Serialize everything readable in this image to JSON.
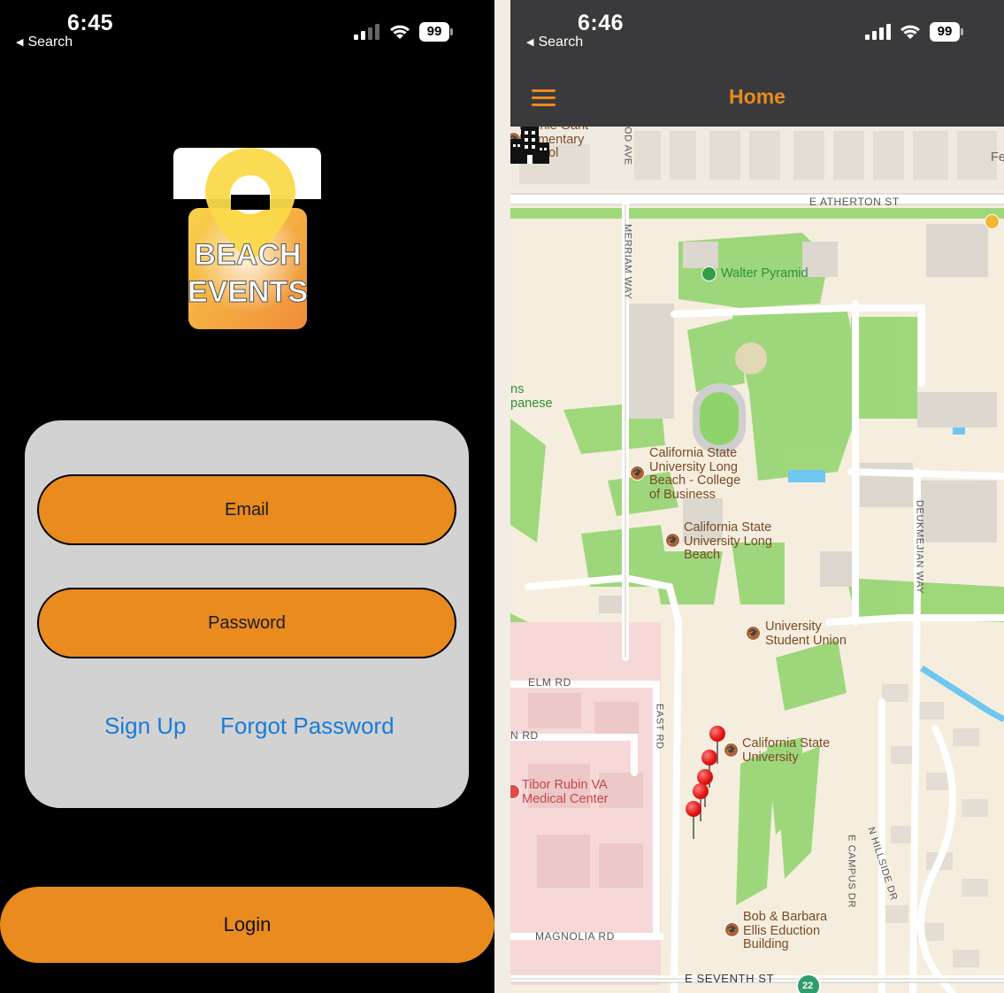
{
  "left_screen": {
    "status_bar": {
      "time": "6:45",
      "back_label": "Search",
      "battery": "99"
    },
    "logo": {
      "line1": "BEACH",
      "line2": "EVENTS"
    },
    "form": {
      "email_placeholder": "Email",
      "password_placeholder": "Password",
      "signup_label": "Sign Up",
      "forgot_label": "Forgot Password"
    },
    "login_label": "Login"
  },
  "right_screen": {
    "status_bar": {
      "time": "6:46",
      "back_label": "Search",
      "battery": "99"
    },
    "nav": {
      "title": "Home",
      "menu_icon": "hamburger-icon"
    },
    "map": {
      "places": {
        "elementary": "Minnie Gant\nElementary\nSchool",
        "walter_pyramid": "Walter Pyramid",
        "business": "California State\nUniversity Long\nBeach - College\nof Business",
        "csulb": "California State\nUniversity Long\nBeach",
        "student_union": "University\nStudent Union",
        "csu": "California State\nUniversity",
        "va_center": "Tibor Rubin VA\nMedical Center",
        "ellis": "Bob & Barbara\nEllis Eduction\nBuilding",
        "japanese": "ns\npanese",
        "fe": "Fe"
      },
      "roads": {
        "atherton": "E ATHERTON ST",
        "merriam": "MERRIAM WAY",
        "od_ave": "OD AVE",
        "deukmejian": "DEUKMEJIAN WAY",
        "elm": "ELM RD",
        "east_rd": "EAST RD",
        "n_rd": "N RD",
        "magnolia": "MAGNOLIA RD",
        "campus_dr": "E CAMPUS DR",
        "hillside": "N HILLSIDE DR",
        "seventh": "E SEVENTH ST",
        "route": "22"
      }
    }
  },
  "colors": {
    "accent_orange": "#e98b1e",
    "link_blue": "#1a7cd6",
    "panel_grey": "#d2d2d2",
    "nav_bar": "#3a3a3c"
  }
}
